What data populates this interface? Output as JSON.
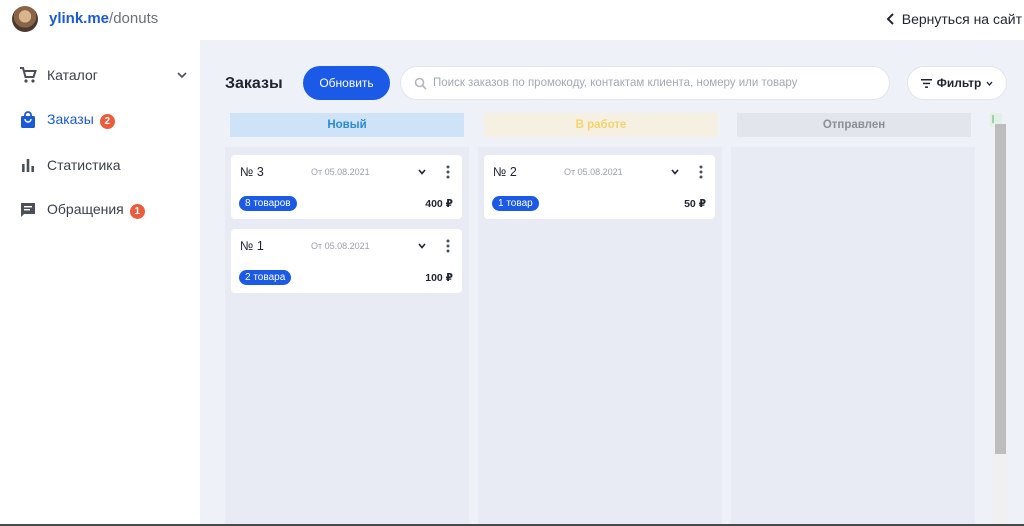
{
  "header": {
    "brand_host": "ylink.me",
    "brand_path": "/donuts",
    "back_label": "Вернуться на сайт"
  },
  "sidebar": {
    "items": [
      {
        "label": "Каталог",
        "icon": "cart-icon",
        "expandable": true
      },
      {
        "label": "Заказы",
        "icon": "shopping-bag-icon",
        "badge": "2",
        "active": true
      },
      {
        "label": "Статистика",
        "icon": "bar-chart-icon"
      },
      {
        "label": "Обращения",
        "icon": "message-icon",
        "badge": "1"
      }
    ]
  },
  "toolbar": {
    "title": "Заказы",
    "refresh_label": "Обновить",
    "search_placeholder": "Поиск заказов по промокоду, контактам клиента, номеру или товару",
    "filter_label": "Фильтр"
  },
  "columns": [
    {
      "label": "Новый",
      "color": "#2b8ad6"
    },
    {
      "label": "В работе",
      "color": "#f3d46b"
    },
    {
      "label": "Отправлен",
      "color": "#8b8e96"
    }
  ],
  "orders": {
    "new": [
      {
        "number": "№ 3",
        "date": "От 05.08.2021",
        "items": "8 товаров",
        "price": "400 ₽"
      },
      {
        "number": "№ 1",
        "date": "От 05.08.2021",
        "items": "2 товара",
        "price": "100 ₽"
      }
    ],
    "in_progress": [
      {
        "number": "№ 2",
        "date": "От 05.08.2021",
        "items": "1 товар",
        "price": "50 ₽"
      }
    ]
  },
  "colors": {
    "accent": "#1a5ae6",
    "badge": "#ee5a3c"
  }
}
